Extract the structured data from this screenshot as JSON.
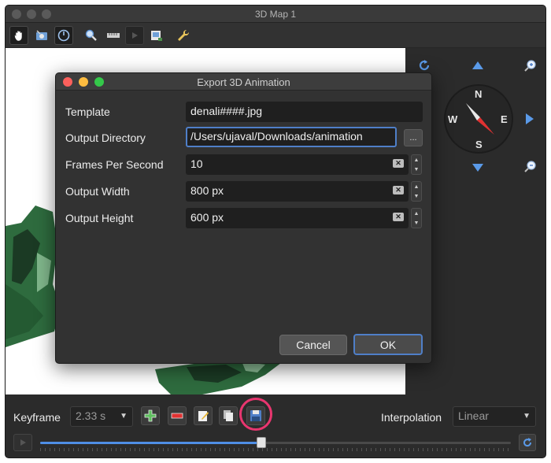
{
  "window": {
    "title": "3D Map 1"
  },
  "toolbar": {
    "icons": [
      "pan-hand-icon",
      "camera-icon",
      "identify-icon",
      "zoom-icon",
      "measure-icon",
      "play-icon",
      "export-image-icon",
      "wrench-icon"
    ]
  },
  "navigation": {
    "north": "N",
    "south": "S",
    "east": "E",
    "west": "W"
  },
  "dialog": {
    "title": "Export 3D Animation",
    "fields": [
      {
        "label": "Template",
        "value": "denali####.jpg"
      },
      {
        "label": "Output Directory",
        "value": "/Users/ujaval/Downloads/animation",
        "browse_label": "..."
      },
      {
        "label": "Frames Per Second",
        "value": "10"
      },
      {
        "label": "Output Width",
        "value": "800 px"
      },
      {
        "label": "Output Height",
        "value": "600 px"
      }
    ],
    "cancel_label": "Cancel",
    "ok_label": "OK"
  },
  "animation": {
    "keyframe_label": "Keyframe",
    "keyframe_value": "2.33 s",
    "interpolation_label": "Interpolation",
    "interpolation_value": "Linear",
    "timeline_progress": 0.47
  },
  "colors": {
    "accent": "#4f7fc8",
    "highlight_ring": "#e8366f",
    "slider_fill": "#4f8fe6",
    "terrain": "#2e6b3e"
  }
}
